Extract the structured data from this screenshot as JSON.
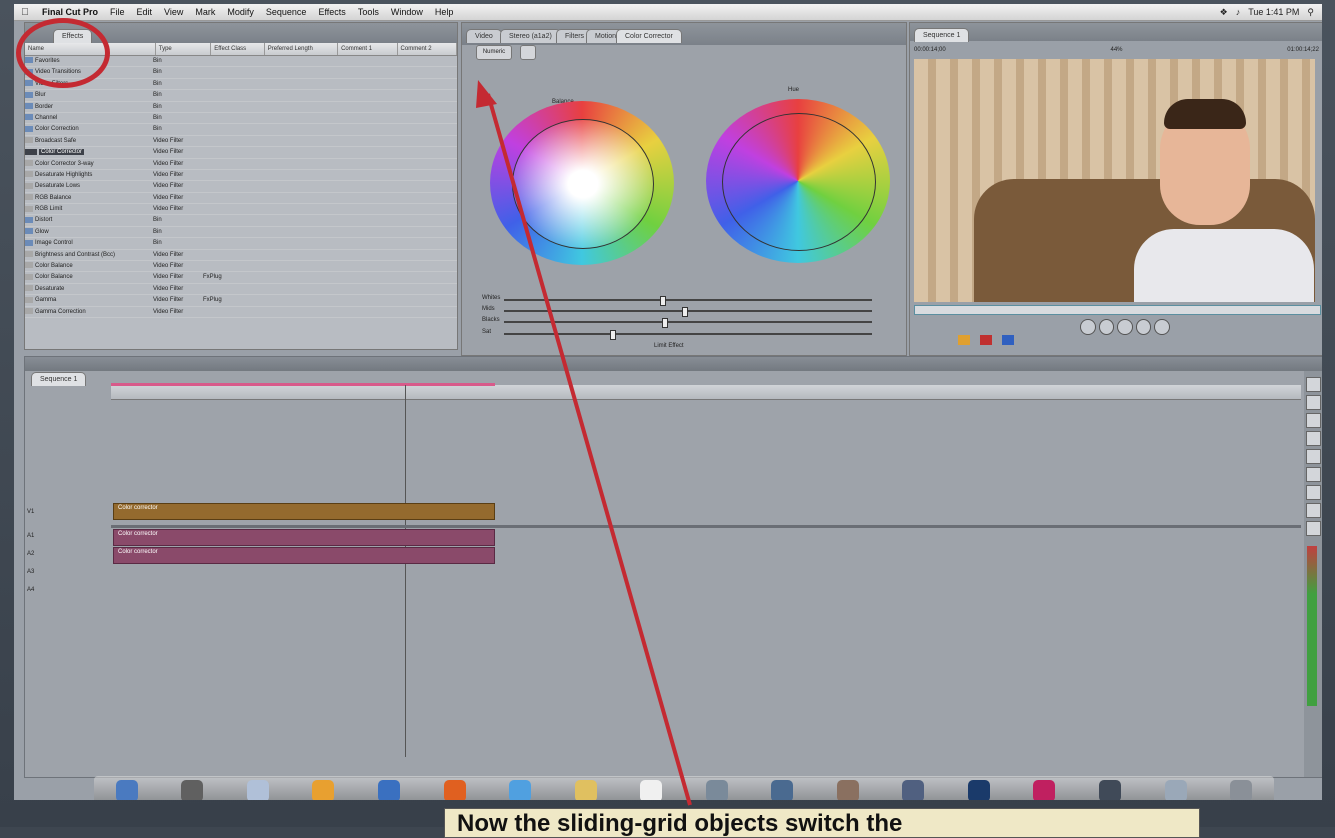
{
  "menubar": {
    "app": "Final Cut Pro",
    "items": [
      "File",
      "Edit",
      "View",
      "Mark",
      "Modify",
      "Sequence",
      "Effects",
      "Tools",
      "Window",
      "Help"
    ],
    "clock": "Tue 1:41 PM"
  },
  "browser": {
    "tabs": [
      "Effects"
    ],
    "columns": [
      "Name",
      "Type",
      "Effect Class",
      "Preferred Length",
      "Comment 1",
      "Comment 2"
    ],
    "rows": [
      {
        "name": "Favorites",
        "type": "Bin"
      },
      {
        "name": "Video Transitions",
        "type": "Bin"
      },
      {
        "name": "Video Filters",
        "type": "Bin"
      },
      {
        "name": "Blur",
        "type": "Bin"
      },
      {
        "name": "Border",
        "type": "Bin"
      },
      {
        "name": "Channel",
        "type": "Bin"
      },
      {
        "name": "Color Correction",
        "type": "Bin"
      },
      {
        "name": "Broadcast Safe",
        "type": "Video Filter"
      },
      {
        "name": "Color Corrector",
        "type": "Video Filter",
        "selected": true
      },
      {
        "name": "Color Corrector 3-way",
        "type": "Video Filter"
      },
      {
        "name": "Desaturate Highlights",
        "type": "Video Filter"
      },
      {
        "name": "Desaturate Lows",
        "type": "Video Filter"
      },
      {
        "name": "RGB Balance",
        "type": "Video Filter"
      },
      {
        "name": "RGB Limit",
        "type": "Video Filter"
      },
      {
        "name": "Distort",
        "type": "Bin"
      },
      {
        "name": "Glow",
        "type": "Bin"
      },
      {
        "name": "Image Control",
        "type": "Bin"
      },
      {
        "name": "Brightness and Contrast (Bcc)",
        "type": "Video Filter"
      },
      {
        "name": "Color Balance",
        "type": "Video Filter"
      },
      {
        "name": "Color Balance",
        "type": "Video Filter",
        "cls": "FxPlug"
      },
      {
        "name": "Desaturate",
        "type": "Video Filter"
      },
      {
        "name": "Gamma",
        "type": "Video Filter",
        "cls": "FxPlug"
      },
      {
        "name": "Gamma Correction",
        "type": "Video Filter"
      }
    ]
  },
  "color_corrector": {
    "tabs": [
      "Video",
      "Stereo (a1a2)",
      "Filters",
      "Motion",
      "Color Corrector"
    ],
    "numeric_label": "Numeric",
    "balance_label": "Balance",
    "hue_label": "Hue",
    "sliders": [
      "Whites",
      "Mids",
      "Blacks",
      "Sat"
    ],
    "limit_effect": "Limit Effect"
  },
  "canvas": {
    "tab": "Sequence 1",
    "timecode_left": "00:00:14;00",
    "zoom": "44%",
    "timecode_right": "01:00:14;22"
  },
  "timeline": {
    "tab": "Sequence 1",
    "clip_video": "Color corrector",
    "clip_audio_1": "Color corrector",
    "clip_audio_2": "Color corrector",
    "tracks": [
      "V1",
      "A1",
      "A2",
      "A3",
      "A4"
    ]
  },
  "caption": {
    "text": "Now the sliding-grid objects switch the"
  },
  "colors": {
    "annotation": "#c42a32",
    "video_clip": "#946a2e",
    "audio_clip": "#8a4a6a"
  }
}
